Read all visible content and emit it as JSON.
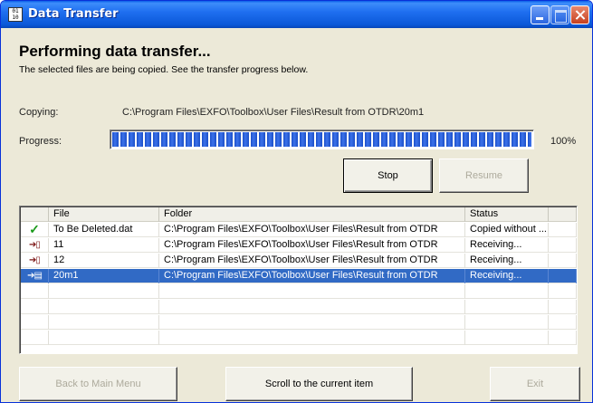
{
  "window": {
    "title": "Data Transfer",
    "icon": "app-window-icon"
  },
  "header": {
    "heading": "Performing data transfer...",
    "subtext": "The selected files are being copied. See the transfer progress below."
  },
  "status": {
    "copying_label": "Copying:",
    "copying_path": "C:\\Program Files\\EXFO\\Toolbox\\User Files\\Result from OTDR\\20m1",
    "progress_label": "Progress:",
    "progress_percent": "100%",
    "progress_value": 1.0
  },
  "buttons": {
    "stop": "Stop",
    "resume": "Resume",
    "back": "Back to Main Menu",
    "scroll": "Scroll to the current item",
    "exit": "Exit"
  },
  "table": {
    "columns": [
      "",
      "File",
      "Folder",
      "Status",
      ""
    ],
    "rows": [
      {
        "icon": "checkmark-icon",
        "file": "To Be Deleted.dat",
        "folder": "C:\\Program Files\\EXFO\\Toolbox\\User Files\\Result from OTDR",
        "status": "Copied without ...",
        "selected": false
      },
      {
        "icon": "receiving-arrow-icon",
        "file": "11",
        "folder": "C:\\Program Files\\EXFO\\Toolbox\\User Files\\Result from OTDR",
        "status": "Receiving...",
        "selected": false
      },
      {
        "icon": "receiving-arrow-icon",
        "file": "12",
        "folder": "C:\\Program Files\\EXFO\\Toolbox\\User Files\\Result from OTDR",
        "status": "Receiving...",
        "selected": false
      },
      {
        "icon": "receiving-arrow-icon",
        "file": "20m1",
        "folder": "C:\\Program Files\\EXFO\\Toolbox\\User Files\\Result from OTDR",
        "status": "Receiving...",
        "selected": true
      }
    ]
  },
  "colors": {
    "titlebar": "#0b58d8",
    "selection": "#316ac5",
    "progress": "#1b4fc8",
    "check": "#1a9a1a"
  }
}
